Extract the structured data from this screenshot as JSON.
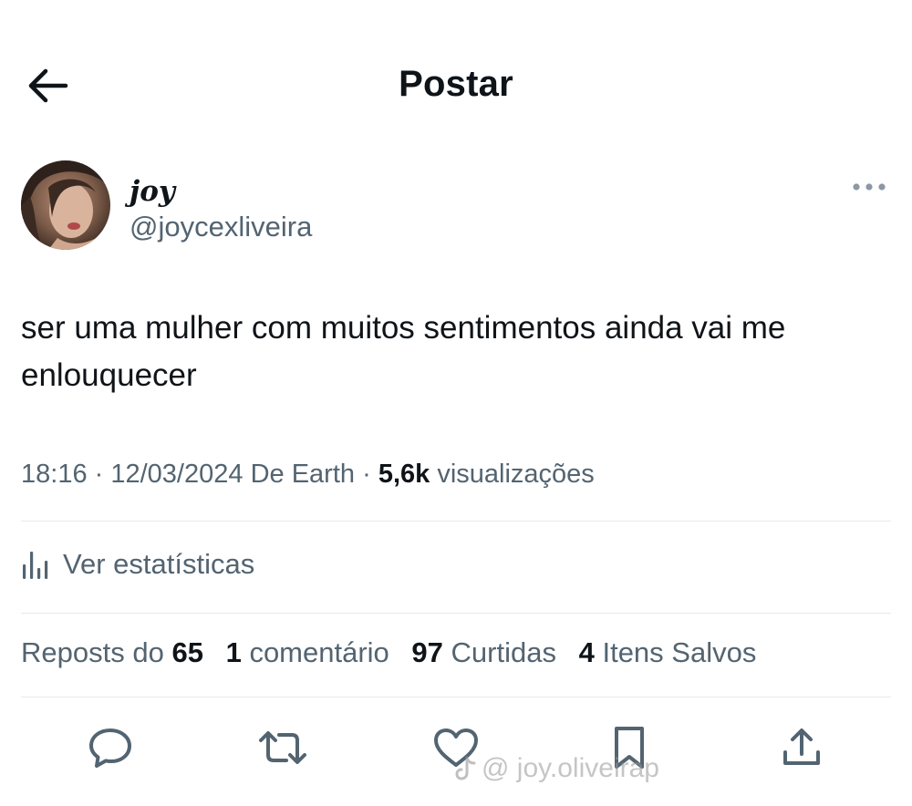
{
  "header": {
    "title": "Postar",
    "back_icon": "arrow-left-icon"
  },
  "author": {
    "display_name": "joy",
    "handle": "@joycexliveira",
    "more_icon": "more-horizontal-icon"
  },
  "tweet": {
    "text": "ser uma mulher com muitos sentimentos ainda vai me enlouquecer"
  },
  "meta": {
    "time": "18:16",
    "date": "12/03/2024",
    "source": "De Earth",
    "views_count": "5,6k",
    "views_label": "visualizações"
  },
  "stats_link": {
    "label": "Ver estatísticas",
    "icon": "analytics-bars-icon"
  },
  "engagement": {
    "reposts_label": "Reposts do",
    "reposts_count": "65",
    "comments_count": "1",
    "comments_label": "comentário",
    "likes_count": "97",
    "likes_label": "Curtidas",
    "saves_count": "4",
    "saves_label": "Itens Salvos"
  },
  "actions": [
    "reply-icon",
    "repost-icon",
    "like-icon",
    "bookmark-icon",
    "share-icon"
  ],
  "watermark": {
    "text": "@ joy.oliveirap",
    "icon": "tiktok-icon"
  },
  "colors": {
    "text_primary": "#0f1419",
    "text_secondary": "#536471",
    "divider": "#e6e9eb"
  }
}
